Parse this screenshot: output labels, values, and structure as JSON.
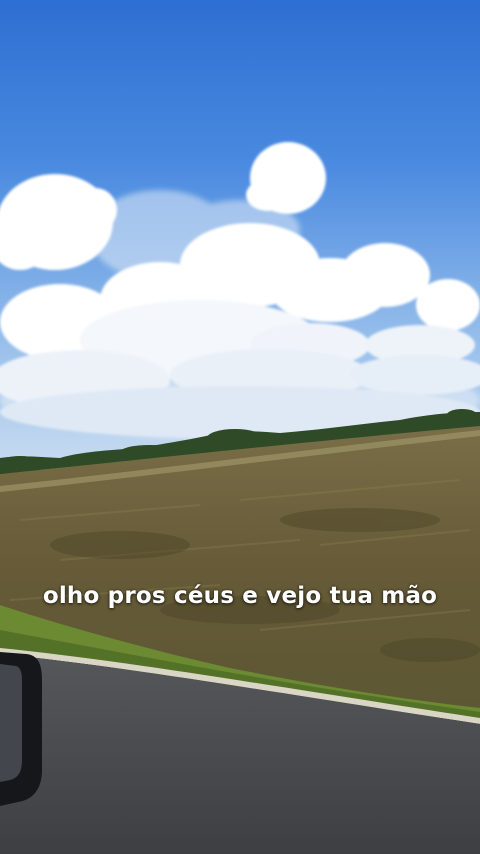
{
  "caption": {
    "text": "olho pros céus e vejo tua mão"
  },
  "colors": {
    "sky_top": "#2f72d4",
    "sky_bottom": "#b9d4ee",
    "field": "#6b5f3c",
    "grass": "#6d8a33",
    "road": "#4d4e52",
    "mirror": "#15171a"
  }
}
